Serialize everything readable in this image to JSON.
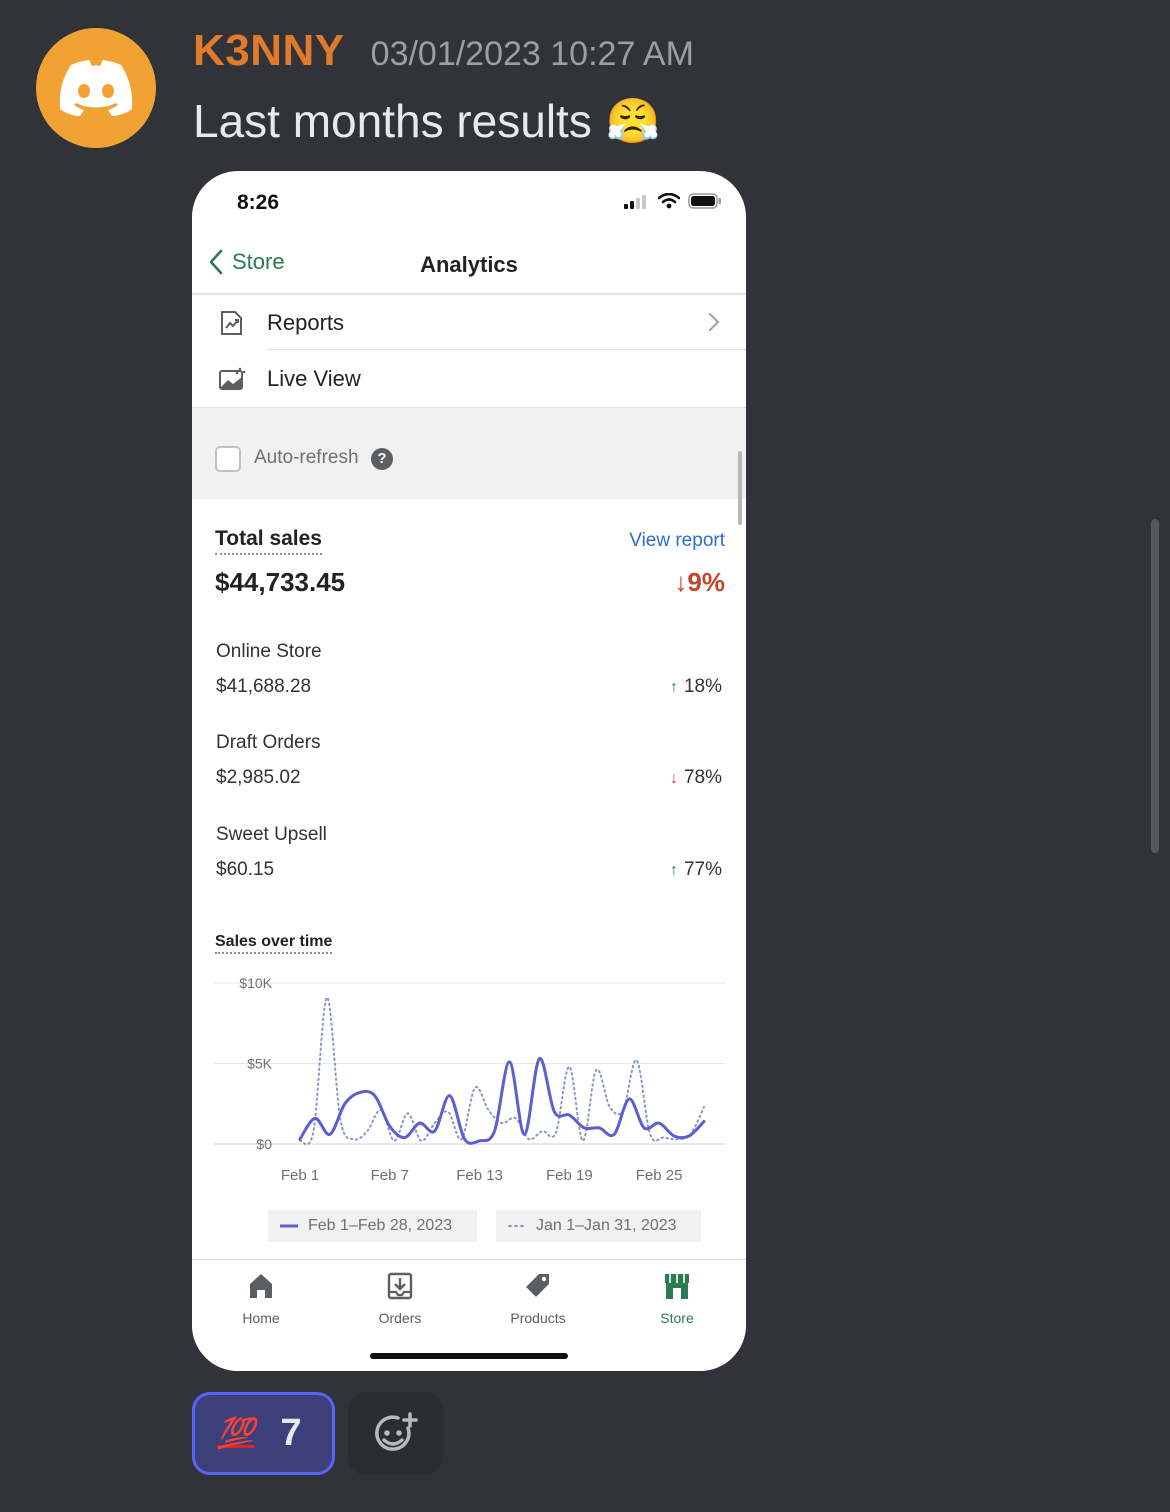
{
  "message": {
    "username": "K3NNY",
    "timestamp": "03/01/2023 10:27 AM",
    "text": "Last months results",
    "emoji": "😤"
  },
  "phone": {
    "status_time": "8:26",
    "nav": {
      "back_label": "Store",
      "title": "Analytics"
    },
    "menu": [
      {
        "label": "Reports",
        "icon": "reports-icon"
      },
      {
        "label": "Live View",
        "icon": "live-view-icon"
      }
    ],
    "auto_refresh": {
      "label": "Auto-refresh",
      "checked": false,
      "help": "?"
    },
    "total_sales": {
      "title": "Total sales",
      "view_report": "View report",
      "amount": "$44,733.45",
      "change_arrow": "↓",
      "change": "9%"
    },
    "channels": [
      {
        "name": "Online Store",
        "amount": "$41,688.28",
        "direction": "up",
        "arrow": "↑",
        "change": "18%"
      },
      {
        "name": "Draft Orders",
        "amount": "$2,985.02",
        "direction": "down",
        "arrow": "↓",
        "change": "78%"
      },
      {
        "name": "Sweet Upsell",
        "amount": "$60.15",
        "direction": "up",
        "arrow": "↑",
        "change": "77%"
      }
    ],
    "tabs": [
      {
        "label": "Home",
        "icon": "home-icon",
        "active": false
      },
      {
        "label": "Orders",
        "icon": "orders-icon",
        "active": false
      },
      {
        "label": "Products",
        "icon": "tag-icon",
        "active": false
      },
      {
        "label": "Store",
        "icon": "store-icon",
        "active": true
      }
    ]
  },
  "chart_data": {
    "type": "line",
    "title": "Sales over time",
    "y_ticks": [
      "$10K",
      "$5K",
      "$0"
    ],
    "ylim": [
      0,
      10000
    ],
    "x_ticks": [
      "Feb 1",
      "Feb 7",
      "Feb 13",
      "Feb 19",
      "Feb 25"
    ],
    "legend": [
      {
        "name": "Feb 1–Feb 28, 2023",
        "style": "solid"
      },
      {
        "name": "Jan 1–Jan 31, 2023",
        "style": "dotted"
      }
    ],
    "series": [
      {
        "name": "Feb 1–Feb 28, 2023",
        "color": "#5c5fcf",
        "style": "solid",
        "x": [
          1,
          2,
          3,
          4,
          5,
          6,
          7,
          8,
          9,
          10,
          11,
          12,
          13,
          14,
          15,
          16,
          17,
          18,
          19,
          20,
          21,
          22,
          23,
          24,
          25,
          26,
          27,
          28
        ],
        "values": [
          300,
          1600,
          600,
          2500,
          3200,
          3000,
          1100,
          400,
          1300,
          800,
          3000,
          300,
          200,
          800,
          5100,
          600,
          5300,
          2000,
          1800,
          1000,
          1000,
          600,
          2800,
          1000,
          1300,
          500,
          500,
          1400
        ]
      },
      {
        "name": "Jan 1–Jan 31, 2023",
        "color": "#8a96c8",
        "style": "dotted",
        "x": [
          1,
          2,
          3,
          4,
          5,
          6,
          7,
          8,
          9,
          10,
          11,
          12,
          13,
          14,
          15,
          16,
          17,
          18,
          19,
          20,
          21,
          22,
          23,
          24,
          25,
          26,
          27,
          28,
          29,
          30,
          31
        ],
        "values": [
          200,
          800,
          9100,
          1500,
          300,
          800,
          2100,
          200,
          1900,
          200,
          1300,
          2000,
          300,
          3500,
          2100,
          1300,
          1600,
          300,
          800,
          700,
          4800,
          200,
          4600,
          2300,
          2100,
          5200,
          600,
          400,
          300,
          600,
          2300
        ]
      }
    ]
  },
  "reaction": {
    "emoji": "💯",
    "count": "7"
  }
}
